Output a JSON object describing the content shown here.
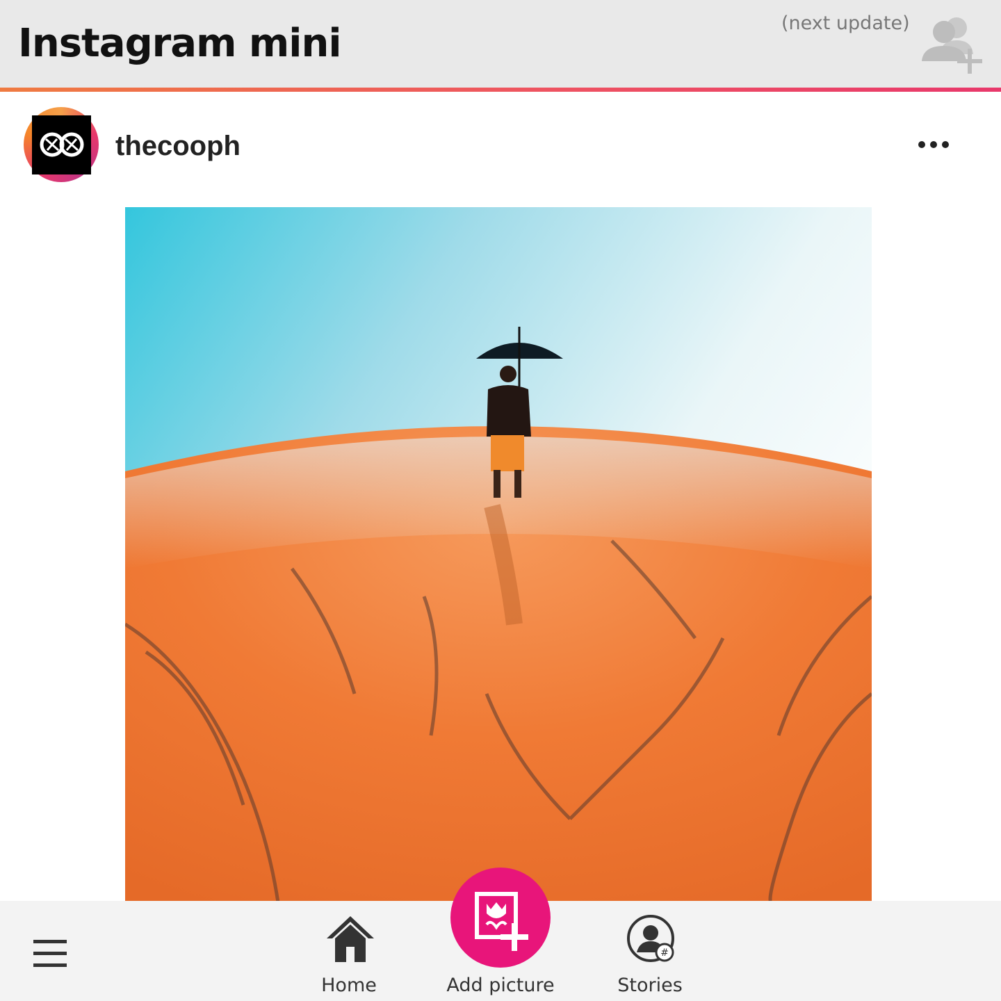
{
  "header": {
    "app_title": "Instagram mini",
    "next_update_label": "(next update)",
    "add_friend_icon": "add-user-icon"
  },
  "post": {
    "username": "thecooph",
    "avatar_icon": "aperture-logo",
    "more_icon": "more-horizontal-icon",
    "photo_description_icon": "photo"
  },
  "bottom_nav": {
    "menu_icon": "hamburger-icon",
    "items": [
      {
        "label": "Home",
        "icon": "home-icon"
      },
      {
        "label": "Add picture",
        "icon": "add-picture-icon"
      },
      {
        "label": "Stories",
        "icon": "stories-icon"
      }
    ]
  },
  "colors": {
    "accent_start": "#ef7b41",
    "accent_end": "#e8386b",
    "fab": "#e8157a",
    "title_bar": "#e9e9e9",
    "bottom_bar": "#f3f3f3"
  }
}
